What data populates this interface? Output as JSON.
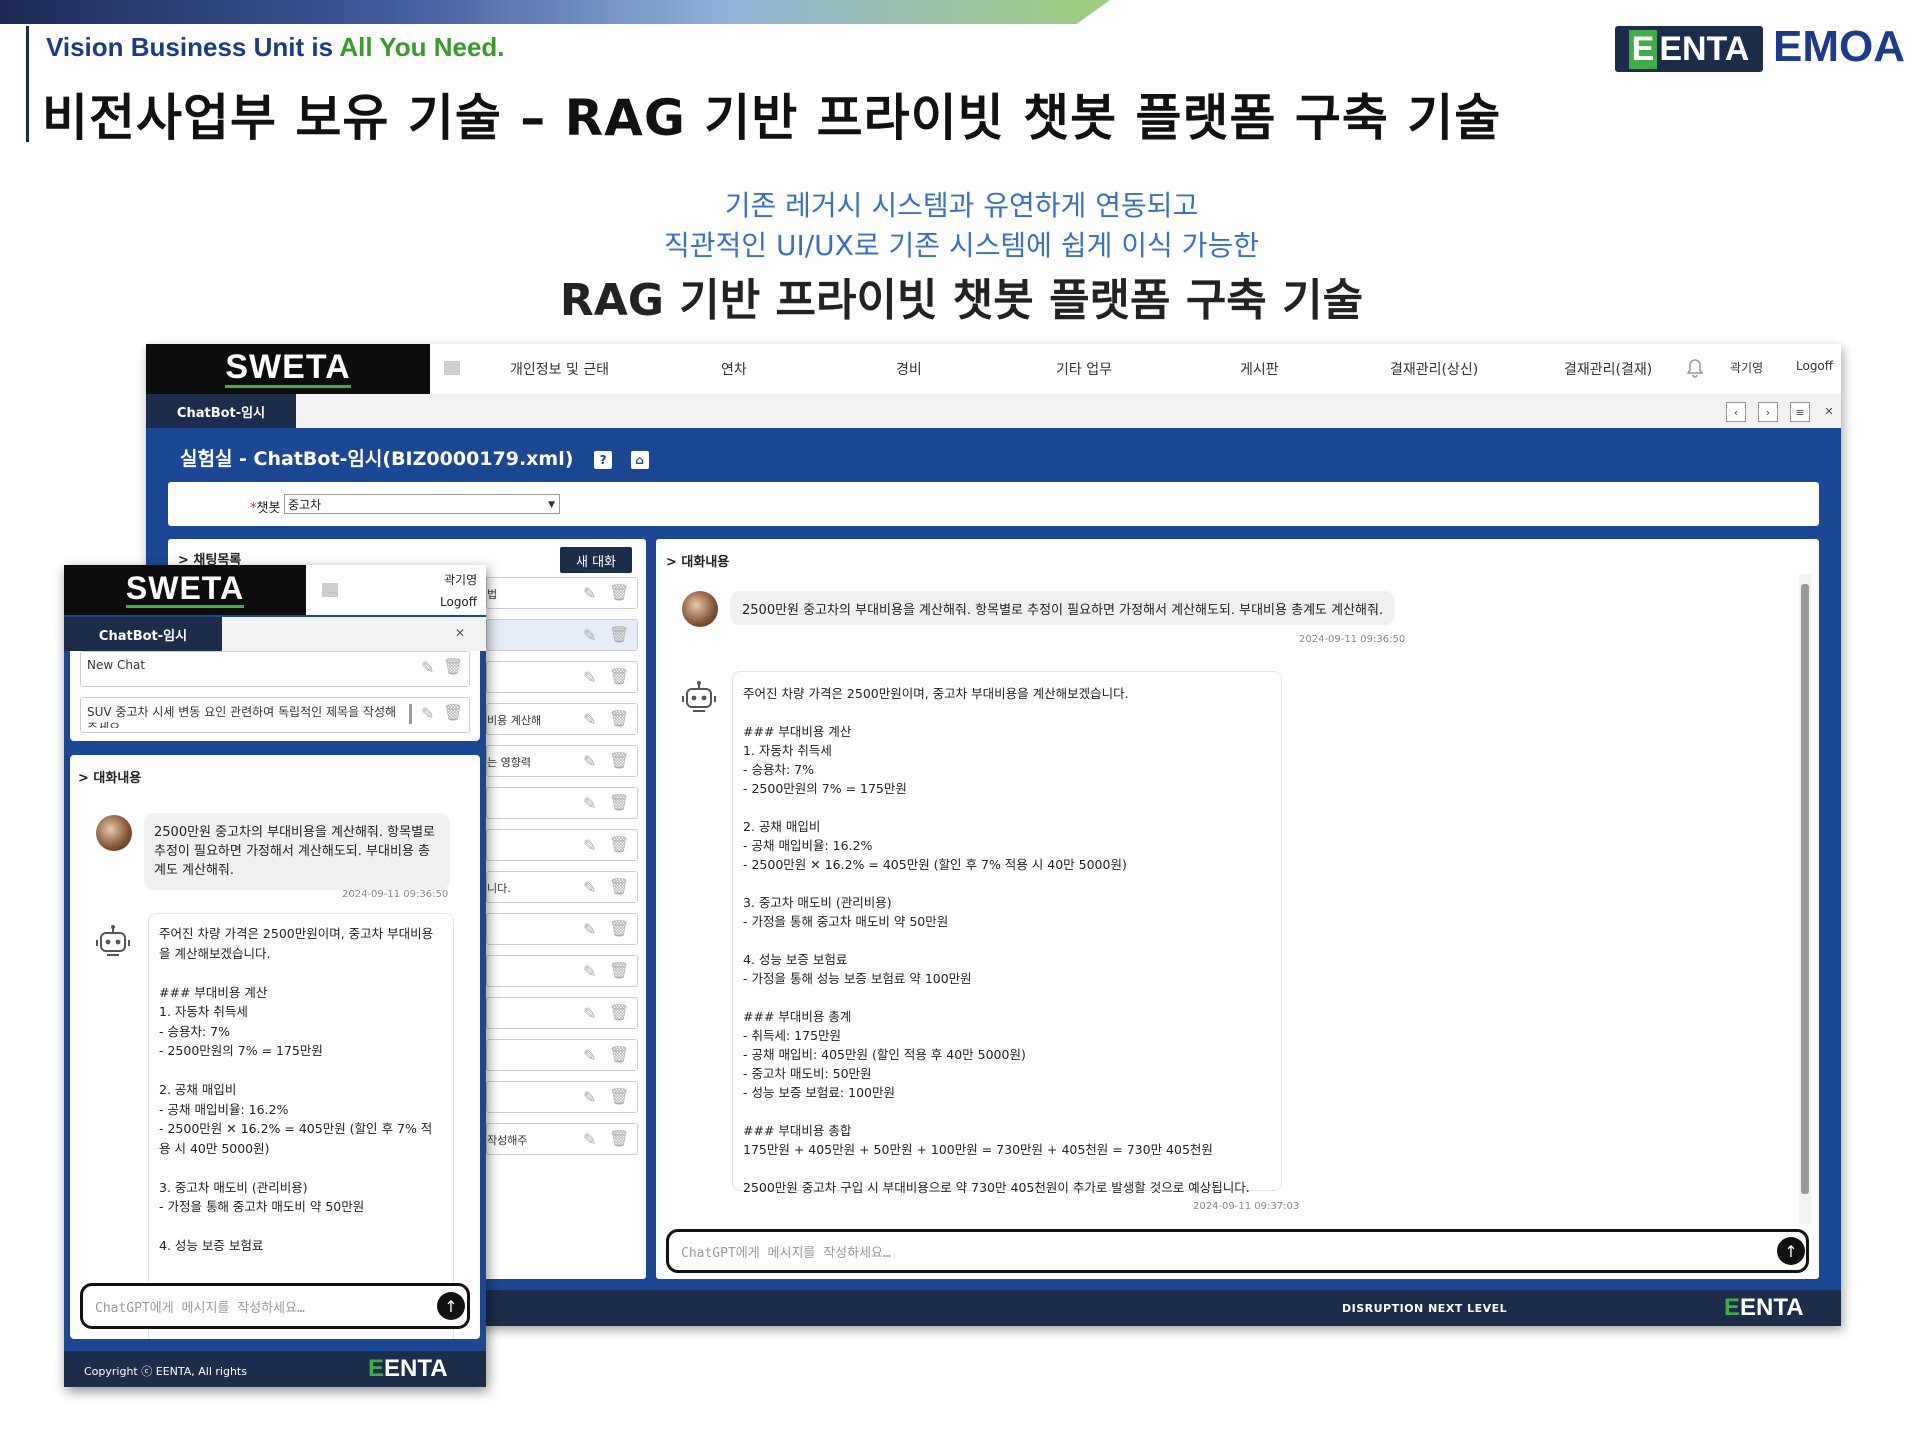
{
  "slide": {
    "tagline_prefix": "Vision Business Unit is ",
    "tagline_highlight": "All You Need.",
    "title": "비전사업부 보유 기술 – RAG 기반 프라이빗 챗봇 플랫폼 구축 기술",
    "logo_eenta": "ENTA",
    "logo_eenta_mark": "E",
    "logo_emoa": "EMOA",
    "subtitle_line1": "기존 레거시 시스템과 유연하게 연동되고",
    "subtitle_line2": "직관적인 UI/UX로 기존 시스템에 쉽게 이식 가능한",
    "heading": "RAG 기반 프라이빗 챗봇 플랫폼 구축 기술",
    "colors": {
      "navy": "#1c2d4c",
      "blue": "#1a4894",
      "green": "#3fae49",
      "accent_text": "#3a6fc4"
    }
  },
  "app": {
    "logo": "SWETA",
    "nav": [
      "개인정보 및 근태",
      "연차",
      "경비",
      "기타 업무",
      "게시판",
      "결재관리(상신)",
      "결재관리(결재)"
    ],
    "user": "곽기영",
    "logoff": "Logoff",
    "tab_label": "ChatBot-임시",
    "page_title": "실험실 - ChatBot-임시(BIZ0000179.xml)",
    "filter_label": "챗봇",
    "filter_value": "중고차",
    "left_panel_title": "> 채팅목록",
    "new_chat_button": "새 대화",
    "list_row_snippets": [
      "법",
      "",
      "",
      "비용 계산해",
      "는 영향력",
      "",
      "",
      "니다.",
      "",
      "",
      "",
      "",
      "",
      "작성해주"
    ],
    "right_panel_title": "> 대화내용",
    "user_message": "2500만원 중고차의 부대비용을 계산해줘. 항목별로 추정이 필요하면 가정해서 계산해도되. 부대비용 총계도 계산해줘.",
    "user_timestamp": "2024-09-11 09:36:50",
    "bot_message": "주어진 차량 가격은 2500만원이며, 중고차 부대비용을 계산해보겠습니다.\n\n### 부대비용 계산\n1. 자동차 취득세\n- 승용차: 7%\n- 2500만원의 7% = 175만원\n\n2. 공채 매입비\n- 공채 매입비율: 16.2%\n- 2500만원 ✕ 16.2% = 405만원 (할인 후 7% 적용 시 40만 5000원)\n\n3. 중고차 매도비 (관리비용)\n- 가정을 통해 중고차 매도비 약 50만원\n\n4. 성능 보증 보험료\n- 가정을 통해 성능 보증 보험료 약 100만원\n\n### 부대비용 총계\n- 취득세: 175만원\n- 공채 매입비: 405만원 (할인 적용 후 40만 5000원)\n- 중고차 매도비: 50만원\n- 성능 보증 보험료: 100만원\n\n### 부대비용 총합\n175만원 + 405만원 + 50만원 + 100만원 = 730만원 + 405천원 = 730만 405천원\n\n2500만원 중고차 구입 시 부대비용으로 약 730만 405천원이 추가로 발생할 것으로 예상됩니다.",
    "bot_timestamp": "2024-09-11 09:37:03",
    "input_placeholder": "ChatGPT에게 메시지를 작성하세요…",
    "footer_text": "DISRUPTION NEXT LEVEL",
    "footer_logo_mark": "E",
    "footer_logo": "ENTA"
  },
  "mobile": {
    "logo": "SWETA",
    "user": "곽기영",
    "logoff": "Logoff",
    "tab_label": "ChatBot-임시",
    "list_items": [
      "New Chat",
      "SUV 중고차 시세 변동 요인 관련하여 독립적인 제목을 작성해주세요"
    ],
    "chat_title": "> 대화내용",
    "user_message": "2500만원 중고차의 부대비용을 계산해줘. 항목별로 추정이 필요하면 가정해서 계산해도되. 부대비용 총계도 계산해줘.",
    "user_timestamp": "2024-09-11 09:36:50",
    "bot_message": "주어진 차량 가격은 2500만원이며, 중고차 부대비용을 계산해보겠습니다.\n\n### 부대비용 계산\n1. 자동차 취득세\n- 승용차: 7%\n- 2500만원의 7% = 175만원\n\n2. 공채 매입비\n- 공채 매입비율: 16.2%\n- 2500만원 ✕ 16.2% = 405만원 (할인 후 7% 적용 시 40만 5000원)\n\n3. 중고차 매도비 (관리비용)\n- 가정을 통해 중고차 매도비 약 50만원\n\n4. 성능 보증 보험료",
    "input_placeholder": "ChatGPT에게 메시지를 작성하세요…",
    "copyright": "Copyright ⓒ EENTA, All rights",
    "footer_logo_mark": "E",
    "footer_logo": "ENTA"
  }
}
